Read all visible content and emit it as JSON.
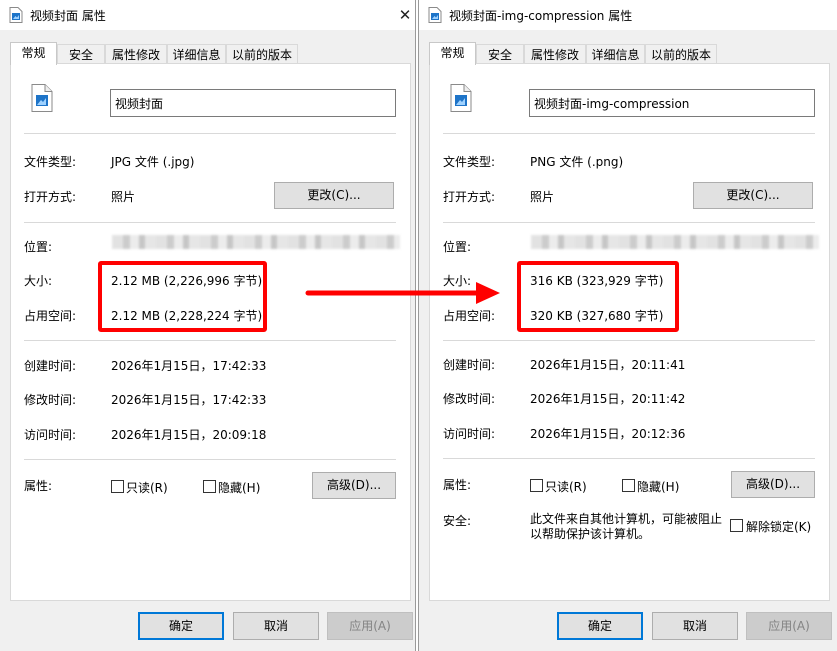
{
  "left": {
    "title": "视频封面 属性",
    "tabs": [
      "常规",
      "安全",
      "属性修改",
      "详细信息",
      "以前的版本"
    ],
    "filename": "视频封面",
    "file_type_label": "文件类型:",
    "file_type_value": "JPG 文件 (.jpg)",
    "open_with_label": "打开方式:",
    "open_with_value": "照片",
    "change_button": "更改(C)...",
    "location_label": "位置:",
    "size_label": "大小:",
    "size_value": "2.12 MB (2,226,996 字节)",
    "disk_size_label": "占用空间:",
    "disk_size_value": "2.12 MB (2,228,224 字节)",
    "created_label": "创建时间:",
    "created_value": "2026年1月15日，17:42:33",
    "modified_label": "修改时间:",
    "modified_value": "2026年1月15日，17:42:33",
    "accessed_label": "访问时间:",
    "accessed_value": "2026年1月15日，20:09:18",
    "attributes_label": "属性:",
    "readonly_label": "只读(R)",
    "hidden_label": "隐藏(H)",
    "advanced_button": "高级(D)...",
    "ok_button": "确定",
    "cancel_button": "取消",
    "apply_button": "应用(A)"
  },
  "right": {
    "title": "视频封面-img-compression 属性",
    "tabs": [
      "常规",
      "安全",
      "属性修改",
      "详细信息",
      "以前的版本"
    ],
    "filename": "视频封面-img-compression",
    "file_type_label": "文件类型:",
    "file_type_value": "PNG 文件 (.png)",
    "open_with_label": "打开方式:",
    "open_with_value": "照片",
    "change_button": "更改(C)...",
    "location_label": "位置:",
    "size_label": "大小:",
    "size_value": "316 KB (323,929 字节)",
    "disk_size_label": "占用空间:",
    "disk_size_value": "320 KB (327,680 字节)",
    "created_label": "创建时间:",
    "created_value": "2026年1月15日，20:11:41",
    "modified_label": "修改时间:",
    "modified_value": "2026年1月15日，20:11:42",
    "accessed_label": "访问时间:",
    "accessed_value": "2026年1月15日，20:12:36",
    "attributes_label": "属性:",
    "readonly_label": "只读(R)",
    "hidden_label": "隐藏(H)",
    "advanced_button": "高级(D)...",
    "security_label": "安全:",
    "security_text": "此文件来自其他计算机，可能被阻止以帮助保护该计算机。",
    "unblock_label": "解除锁定(K)",
    "ok_button": "确定",
    "cancel_button": "取消",
    "apply_button": "应用(A)"
  },
  "icons": {
    "file": "image-file-icon",
    "close": "close-icon",
    "arrow": "arrow-right-icon"
  },
  "colors": {
    "highlight": "#ff0000",
    "default_button_border": "#0078d7",
    "icon_blue": "#1e74c8"
  }
}
